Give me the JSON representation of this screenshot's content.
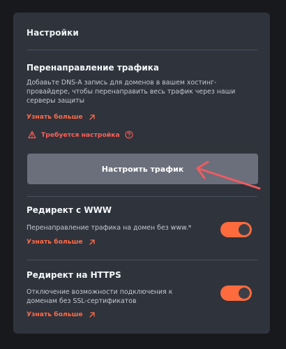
{
  "panel": {
    "title": "Настройки",
    "traffic_redirect": {
      "title": "Перенаправление трафика",
      "description_lines": [
        "Добавьте DNS-A запись для доменов в вашем хостинг-",
        "провайдере, чтобы перенаправить весь трафик через наши",
        "серверы защиты"
      ],
      "learn_more": "Узнать больше",
      "warning_text": "Требуется настройка",
      "button_label": "Настроить трафик"
    },
    "www_redirect": {
      "title": "Редирект с WWW",
      "description_lines": [
        "Перенаправление трафика на домен без www.*"
      ],
      "learn_more": "Узнать больше",
      "toggle_on": true
    },
    "https_redirect": {
      "title": "Редирект на HTTPS",
      "description_lines": [
        "Отключение возможности подключения к",
        "доменам без SSL-сертификатов"
      ],
      "learn_more": "Узнать больше",
      "toggle_on": true
    }
  },
  "colors": {
    "accent": "#ff6b3d",
    "warning": "#ff5f57",
    "panel": "#2f333b",
    "button": "#6a6f7b",
    "annotation_arrow": "#f05b61"
  },
  "icons": {
    "external_link": "arrow-up-right-icon",
    "warning": "warning-triangle-icon",
    "help": "question-circle-icon"
  }
}
